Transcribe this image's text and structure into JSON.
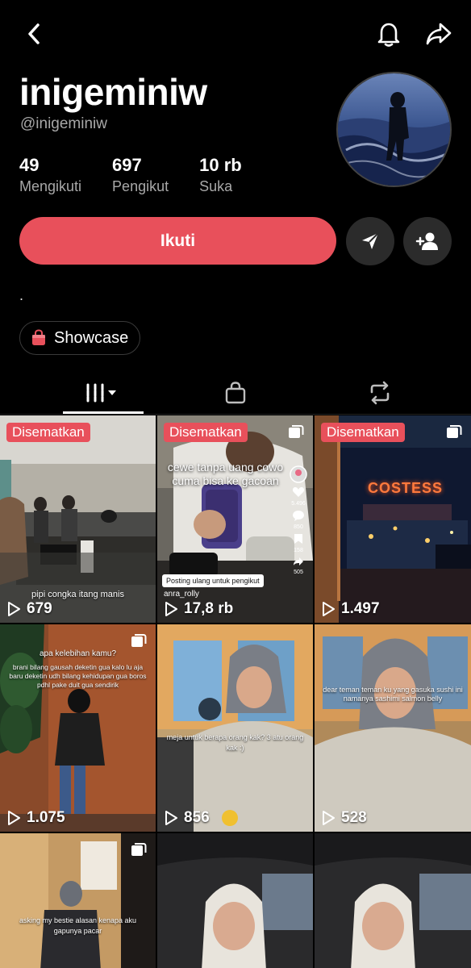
{
  "header": {
    "username": "inigeminiw",
    "handle": "@inigeminiw"
  },
  "stats": [
    {
      "value": "49",
      "label": "Mengikuti"
    },
    {
      "value": "697",
      "label": "Pengikut"
    },
    {
      "value": "10 rb",
      "label": "Suka"
    }
  ],
  "actions": {
    "follow_label": "Ikuti"
  },
  "bio": ".",
  "showcase": {
    "label": "Showcase"
  },
  "tabs": {
    "icons": [
      "grid-icon",
      "shopping-bag-icon",
      "repost-icon"
    ]
  },
  "videos": [
    {
      "pinned_label": "Disematkan",
      "views": "679",
      "caption": "pipi congka itang manis"
    },
    {
      "pinned_label": "Disematkan",
      "views": "17,8 rb",
      "overlay": "cewe tanpa uang cowo cuma bisa ke gacoan",
      "repost_tag": "Posting ulang untuk pengikut",
      "author": "anra_rolly",
      "likes": "5.496",
      "comments": "850",
      "saves": "158",
      "shares": "505"
    },
    {
      "pinned_label": "Disematkan",
      "views": "1.497",
      "sign": "COSTESS"
    },
    {
      "views": "1.075",
      "overlay_title": "apa kelebihan kamu?",
      "overlay": "brani bilang gausah deketin gua kalo lu aja baru deketin udh bilang kehidupan gua boros pdhl pake duit gua sendirik"
    },
    {
      "views": "856",
      "overlay": "meja untuk berapa orang kak? 3 atu orang kak :)"
    },
    {
      "views": "528",
      "overlay": "dear teman teman ku yang gasuka sushi ini namanya sashimi salmon belly"
    },
    {
      "overlay": "asking my bestie alasan kenapa aku gapunya pacar"
    },
    {},
    {}
  ],
  "colors": {
    "accent": "#e8505b",
    "background": "#000000",
    "secondary_text": "#a8a8a8"
  }
}
